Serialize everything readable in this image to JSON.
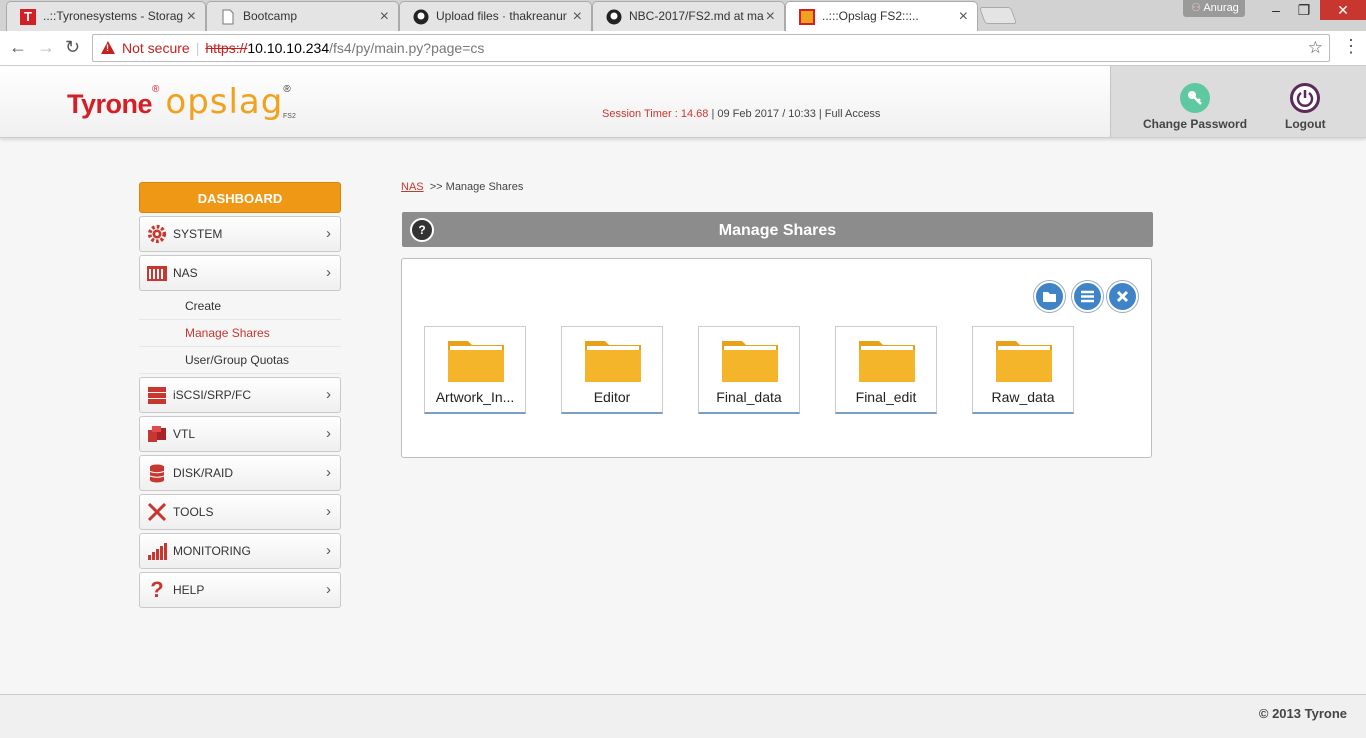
{
  "browser": {
    "tabs": [
      {
        "title": "..::Tyronesystems - Storag",
        "icon": "tyrone-favicon"
      },
      {
        "title": "Bootcamp",
        "icon": "blank-page-icon"
      },
      {
        "title": "Upload files · thakreanur",
        "icon": "github-icon"
      },
      {
        "title": "NBC-2017/FS2.md at ma",
        "icon": "github-icon"
      },
      {
        "title": "..:::Opslag FS2:::..",
        "icon": "opslag-favicon"
      }
    ],
    "user": "Anurag",
    "not_secure_label": "Not secure",
    "url_scheme": "https://",
    "url_host": "10.10.10.234",
    "url_path": "/fs4/py/main.py?page=cs"
  },
  "header": {
    "logo_brand": "Tyrone",
    "logo_product": "opslag",
    "logo_sub": "FS2",
    "session_label": "Session Timer : 14.68",
    "session_info": "| 09 Feb 2017 / 10:33 | Full Access",
    "change_password": "Change Password",
    "logout": "Logout"
  },
  "sidebar": {
    "dashboard": "DASHBOARD",
    "items": [
      {
        "label": "SYSTEM",
        "icon": "gear-icon"
      },
      {
        "label": "NAS",
        "icon": "nas-icon"
      },
      {
        "label": "iSCSI/SRP/FC",
        "icon": "server-icon"
      },
      {
        "label": "VTL",
        "icon": "tape-library-icon"
      },
      {
        "label": "DISK/RAID",
        "icon": "database-icon"
      },
      {
        "label": "TOOLS",
        "icon": "tools-icon"
      },
      {
        "label": "MONITORING",
        "icon": "bar-graph-icon"
      },
      {
        "label": "HELP",
        "icon": "question-icon"
      }
    ],
    "nas_submenu": [
      "Create",
      "Manage Shares",
      "User/Group Quotas"
    ]
  },
  "breadcrumb": {
    "root": "NAS",
    "current": ">> Manage Shares"
  },
  "panel": {
    "title": "Manage Shares",
    "shares": [
      "Artwork_In...",
      "Editor",
      "Final_data",
      "Final_edit",
      "Raw_data"
    ]
  },
  "footer": {
    "copyright": "© 2013 Tyrone"
  },
  "colors": {
    "accent_orange": "#ee9816",
    "brand_red": "#d51f26",
    "link_red": "#c7372f",
    "tool_blue": "#3e84c6"
  }
}
